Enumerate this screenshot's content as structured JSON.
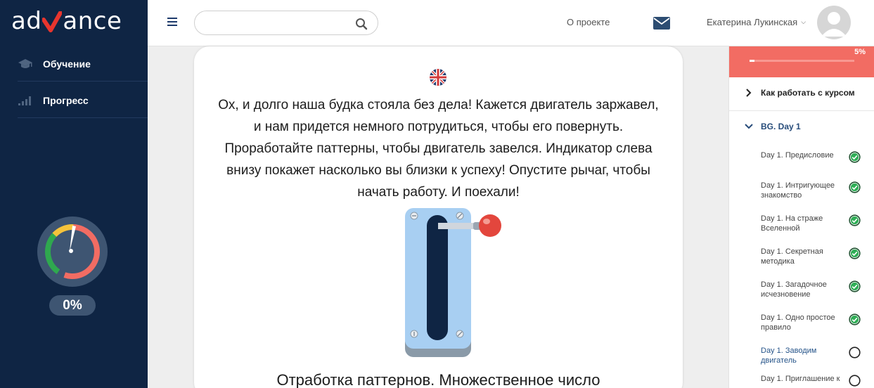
{
  "app": {
    "logo_text_left": "ad",
    "logo_text_right": "ance"
  },
  "sidebar": {
    "items": [
      {
        "label": "Обучение",
        "icon": "graduation-cap-icon"
      },
      {
        "label": "Прогресс",
        "icon": "bar-chart-icon"
      }
    ],
    "gauge_percent": "0%",
    "gauge_value": 0
  },
  "topbar": {
    "search_placeholder": "",
    "about_label": "О проекте",
    "user_name": "Екатерина Лукинская",
    "mail_icon": "envelope-icon",
    "avatar_icon": "user-avatar-icon"
  },
  "main": {
    "flag_icon": "uk-flag-icon",
    "intro_text": "Ох, и долго наша будка стояла без дела! Кажется двигатель заржавел, и нам придется немного потрудиться, чтобы его повернуть. Проработайте паттерны, чтобы двигатель завелся. Индикатор слева внизу покажет насколько вы близки к успеху! Опустите рычаг, чтобы начать работу. И поехали!",
    "section_title": "Отработка паттернов. Множественное число"
  },
  "course_panel": {
    "progress_percent": "5%",
    "progress_value": 0.05,
    "rows": [
      {
        "label": "Как работать с курсом",
        "state": "collapsed"
      },
      {
        "label": "BG. Day 1",
        "state": "expanded"
      }
    ],
    "lessons": [
      {
        "title": "Day 1. Предисловие",
        "done": true
      },
      {
        "title": "Day 1. Интригующее знакомство",
        "done": true
      },
      {
        "title": "Day 1. На страже Вселенной",
        "done": true
      },
      {
        "title": "Day 1. Секретная методика",
        "done": true
      },
      {
        "title": "Day 1. Загадочное исчезновение",
        "done": true
      },
      {
        "title": "Day 1. Одно простое правило",
        "done": true
      },
      {
        "title": "Day 1. Заводим двигатель",
        "done": false,
        "active": true
      },
      {
        "title": "Day 1. Приглашение к",
        "done": false
      }
    ],
    "colors": {
      "progress_bg": "#f26c63",
      "check_green": "#2fae56",
      "accent_blue": "#27558a"
    }
  }
}
